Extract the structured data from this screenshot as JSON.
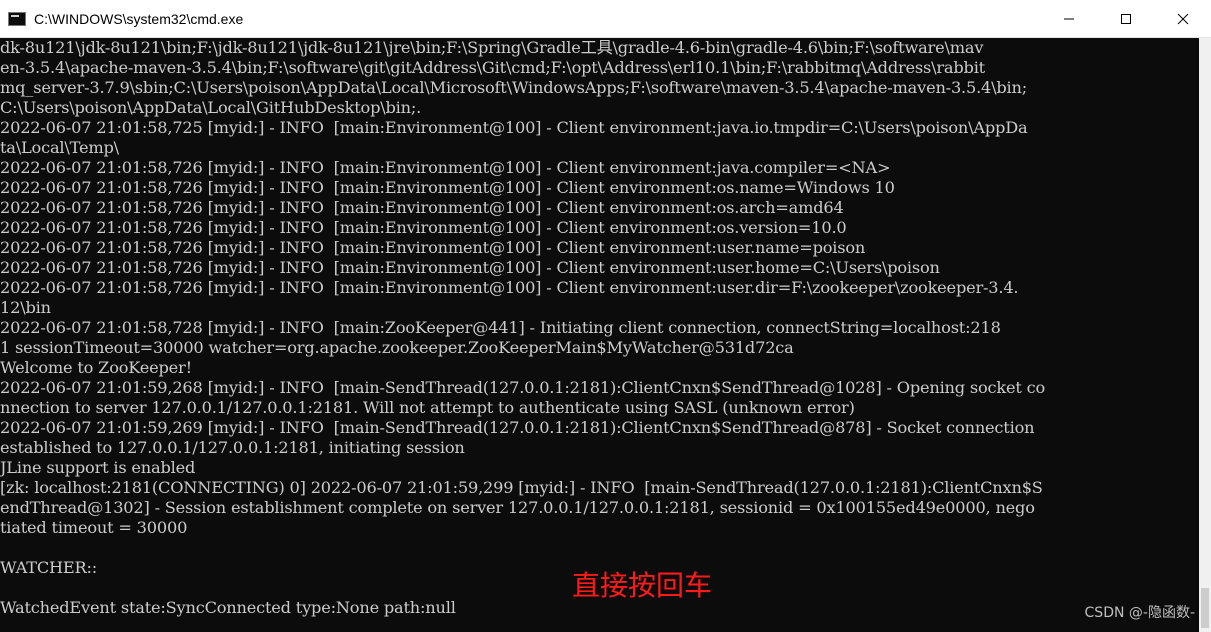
{
  "window": {
    "title": "C:\\WINDOWS\\system32\\cmd.exe",
    "icon": "cmd-icon",
    "controls": [
      "minimize-icon",
      "maximize-icon",
      "close-icon"
    ]
  },
  "console": {
    "lines": [
      "dk-8u121\\jdk-8u121\\bin;F:\\jdk-8u121\\jdk-8u121\\jre\\bin;F:\\Spring\\Gradle工具\\gradle-4.6-bin\\gradle-4.6\\bin;F:\\software\\mav",
      "en-3.5.4\\apache-maven-3.5.4\\bin;F:\\software\\git\\gitAddress\\Git\\cmd;F:\\opt\\Address\\erl10.1\\bin;F:\\rabbitmq\\Address\\rabbit",
      "mq_server-3.7.9\\sbin;C:\\Users\\poison\\AppData\\Local\\Microsoft\\WindowsApps;F:\\software\\maven-3.5.4\\apache-maven-3.5.4\\bin;",
      "C:\\Users\\poison\\AppData\\Local\\GitHubDesktop\\bin;.",
      "2022-06-07 21:01:58,725 [myid:] - INFO  [main:Environment@100] - Client environment:java.io.tmpdir=C:\\Users\\poison\\AppDa",
      "ta\\Local\\Temp\\",
      "2022-06-07 21:01:58,726 [myid:] - INFO  [main:Environment@100] - Client environment:java.compiler=<NA>",
      "2022-06-07 21:01:58,726 [myid:] - INFO  [main:Environment@100] - Client environment:os.name=Windows 10",
      "2022-06-07 21:01:58,726 [myid:] - INFO  [main:Environment@100] - Client environment:os.arch=amd64",
      "2022-06-07 21:01:58,726 [myid:] - INFO  [main:Environment@100] - Client environment:os.version=10.0",
      "2022-06-07 21:01:58,726 [myid:] - INFO  [main:Environment@100] - Client environment:user.name=poison",
      "2022-06-07 21:01:58,726 [myid:] - INFO  [main:Environment@100] - Client environment:user.home=C:\\Users\\poison",
      "2022-06-07 21:01:58,726 [myid:] - INFO  [main:Environment@100] - Client environment:user.dir=F:\\zookeeper\\zookeeper-3.4.",
      "12\\bin",
      "2022-06-07 21:01:58,728 [myid:] - INFO  [main:ZooKeeper@441] - Initiating client connection, connectString=localhost:218",
      "1 sessionTimeout=30000 watcher=org.apache.zookeeper.ZooKeeperMain$MyWatcher@531d72ca",
      "Welcome to ZooKeeper!",
      "2022-06-07 21:01:59,268 [myid:] - INFO  [main-SendThread(127.0.0.1:2181):ClientCnxn$SendThread@1028] - Opening socket co",
      "nnection to server 127.0.0.1/127.0.0.1:2181. Will not attempt to authenticate using SASL (unknown error)",
      "2022-06-07 21:01:59,269 [myid:] - INFO  [main-SendThread(127.0.0.1:2181):ClientCnxn$SendThread@878] - Socket connection",
      "established to 127.0.0.1/127.0.0.1:2181, initiating session",
      "JLine support is enabled",
      "[zk: localhost:2181(CONNECTING) 0] 2022-06-07 21:01:59,299 [myid:] - INFO  [main-SendThread(127.0.0.1:2181):ClientCnxn$S",
      "endThread@1302] - Session establishment complete on server 127.0.0.1/127.0.0.1:2181, sessionid = 0x100155ed49e0000, nego",
      "tiated timeout = 30000",
      "",
      "WATCHER::",
      "",
      "WatchedEvent state:SyncConnected type:None path:null"
    ]
  },
  "annotation": {
    "text": "直接按回车",
    "color": "#ff1a1a"
  },
  "watermark": {
    "text": "CSDN @-隐函数-"
  },
  "colors": {
    "console_bg": "#0c0c0c",
    "console_text": "#cccccc",
    "titlebar_bg": "#ffffff"
  }
}
